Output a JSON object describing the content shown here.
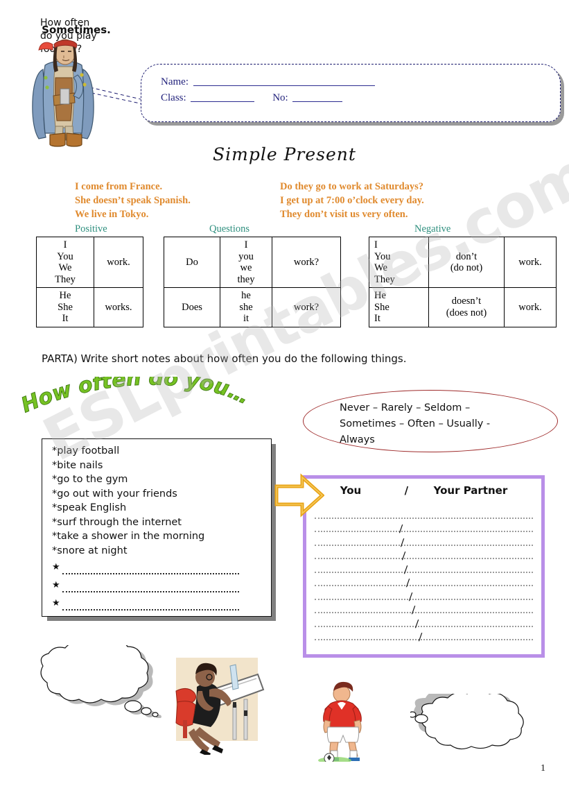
{
  "document": {
    "title": "Simple Present",
    "page_number": "1",
    "watermark": "ESLprintables.com"
  },
  "header": {
    "name_label": "Name:",
    "class_label": "Class:",
    "no_label": "No:"
  },
  "examples": {
    "left": [
      "I come from France.",
      "She doesn’t speak Spanish.",
      "We live in Tokyo."
    ],
    "right": [
      "Do they go to work at Saturdays?",
      "I get up at 7:00 o’clock every day.",
      "They don’t visit us very often."
    ],
    "color": "#e08a2e"
  },
  "tables": {
    "label_color": "#2e8f7e",
    "positive": {
      "label": "Positive",
      "rows": [
        {
          "subjects": "I\nYou\nWe\nThey",
          "verb": "work."
        },
        {
          "subjects": "He\nShe\nIt",
          "verb": "works."
        }
      ]
    },
    "questions": {
      "label": "Questions",
      "rows": [
        {
          "aux": "Do",
          "subjects": "I\nyou\nwe\nthey",
          "verb": "work?"
        },
        {
          "aux": "Does",
          "subjects": "he\nshe\nit",
          "verb": "work?"
        }
      ]
    },
    "negative": {
      "label": "Negative",
      "rows": [
        {
          "subjects": "I\nYou\nWe\nThey",
          "aux": "don’t\n(do not)",
          "verb": "work."
        },
        {
          "subjects": "He\nShe\nIt",
          "aux": "doesn’t\n(does not)",
          "verb": "work."
        }
      ]
    }
  },
  "part_a": {
    "instruction": "PARTA) Write short notes about how often you do the following things.",
    "wordart": "How often do you……?",
    "wordart_color": "#76c223"
  },
  "adverbs": {
    "line1": "Never – Rarely – Seldom –",
    "line2": "Sometimes – Often – Usually -",
    "line3": "Always",
    "border_color": "#9e2a2a"
  },
  "activities": {
    "items": [
      "*play football",
      "*bite nails",
      "*go to the gym",
      "*go out with your friends",
      "*speak English",
      "*surf through the internet",
      "*take a shower in the morning",
      "*snore at night"
    ],
    "blank_bullet": "★",
    "blank_count": 3
  },
  "answer_box": {
    "header_you": "You",
    "header_slash": "/",
    "header_partner": "Your Partner",
    "slash": "/",
    "line_count": 10,
    "border_color": "#b98fe8"
  },
  "bubbles": {
    "question": "How often\ndo you play\nfootball?",
    "answer": "Sometimes."
  },
  "icons": {
    "arrow": "right-arrow-icon",
    "pirate": "pirate-clipart",
    "drafter": "woman-at-drafting-table-clipart",
    "player": "soccer-player-clipart"
  }
}
